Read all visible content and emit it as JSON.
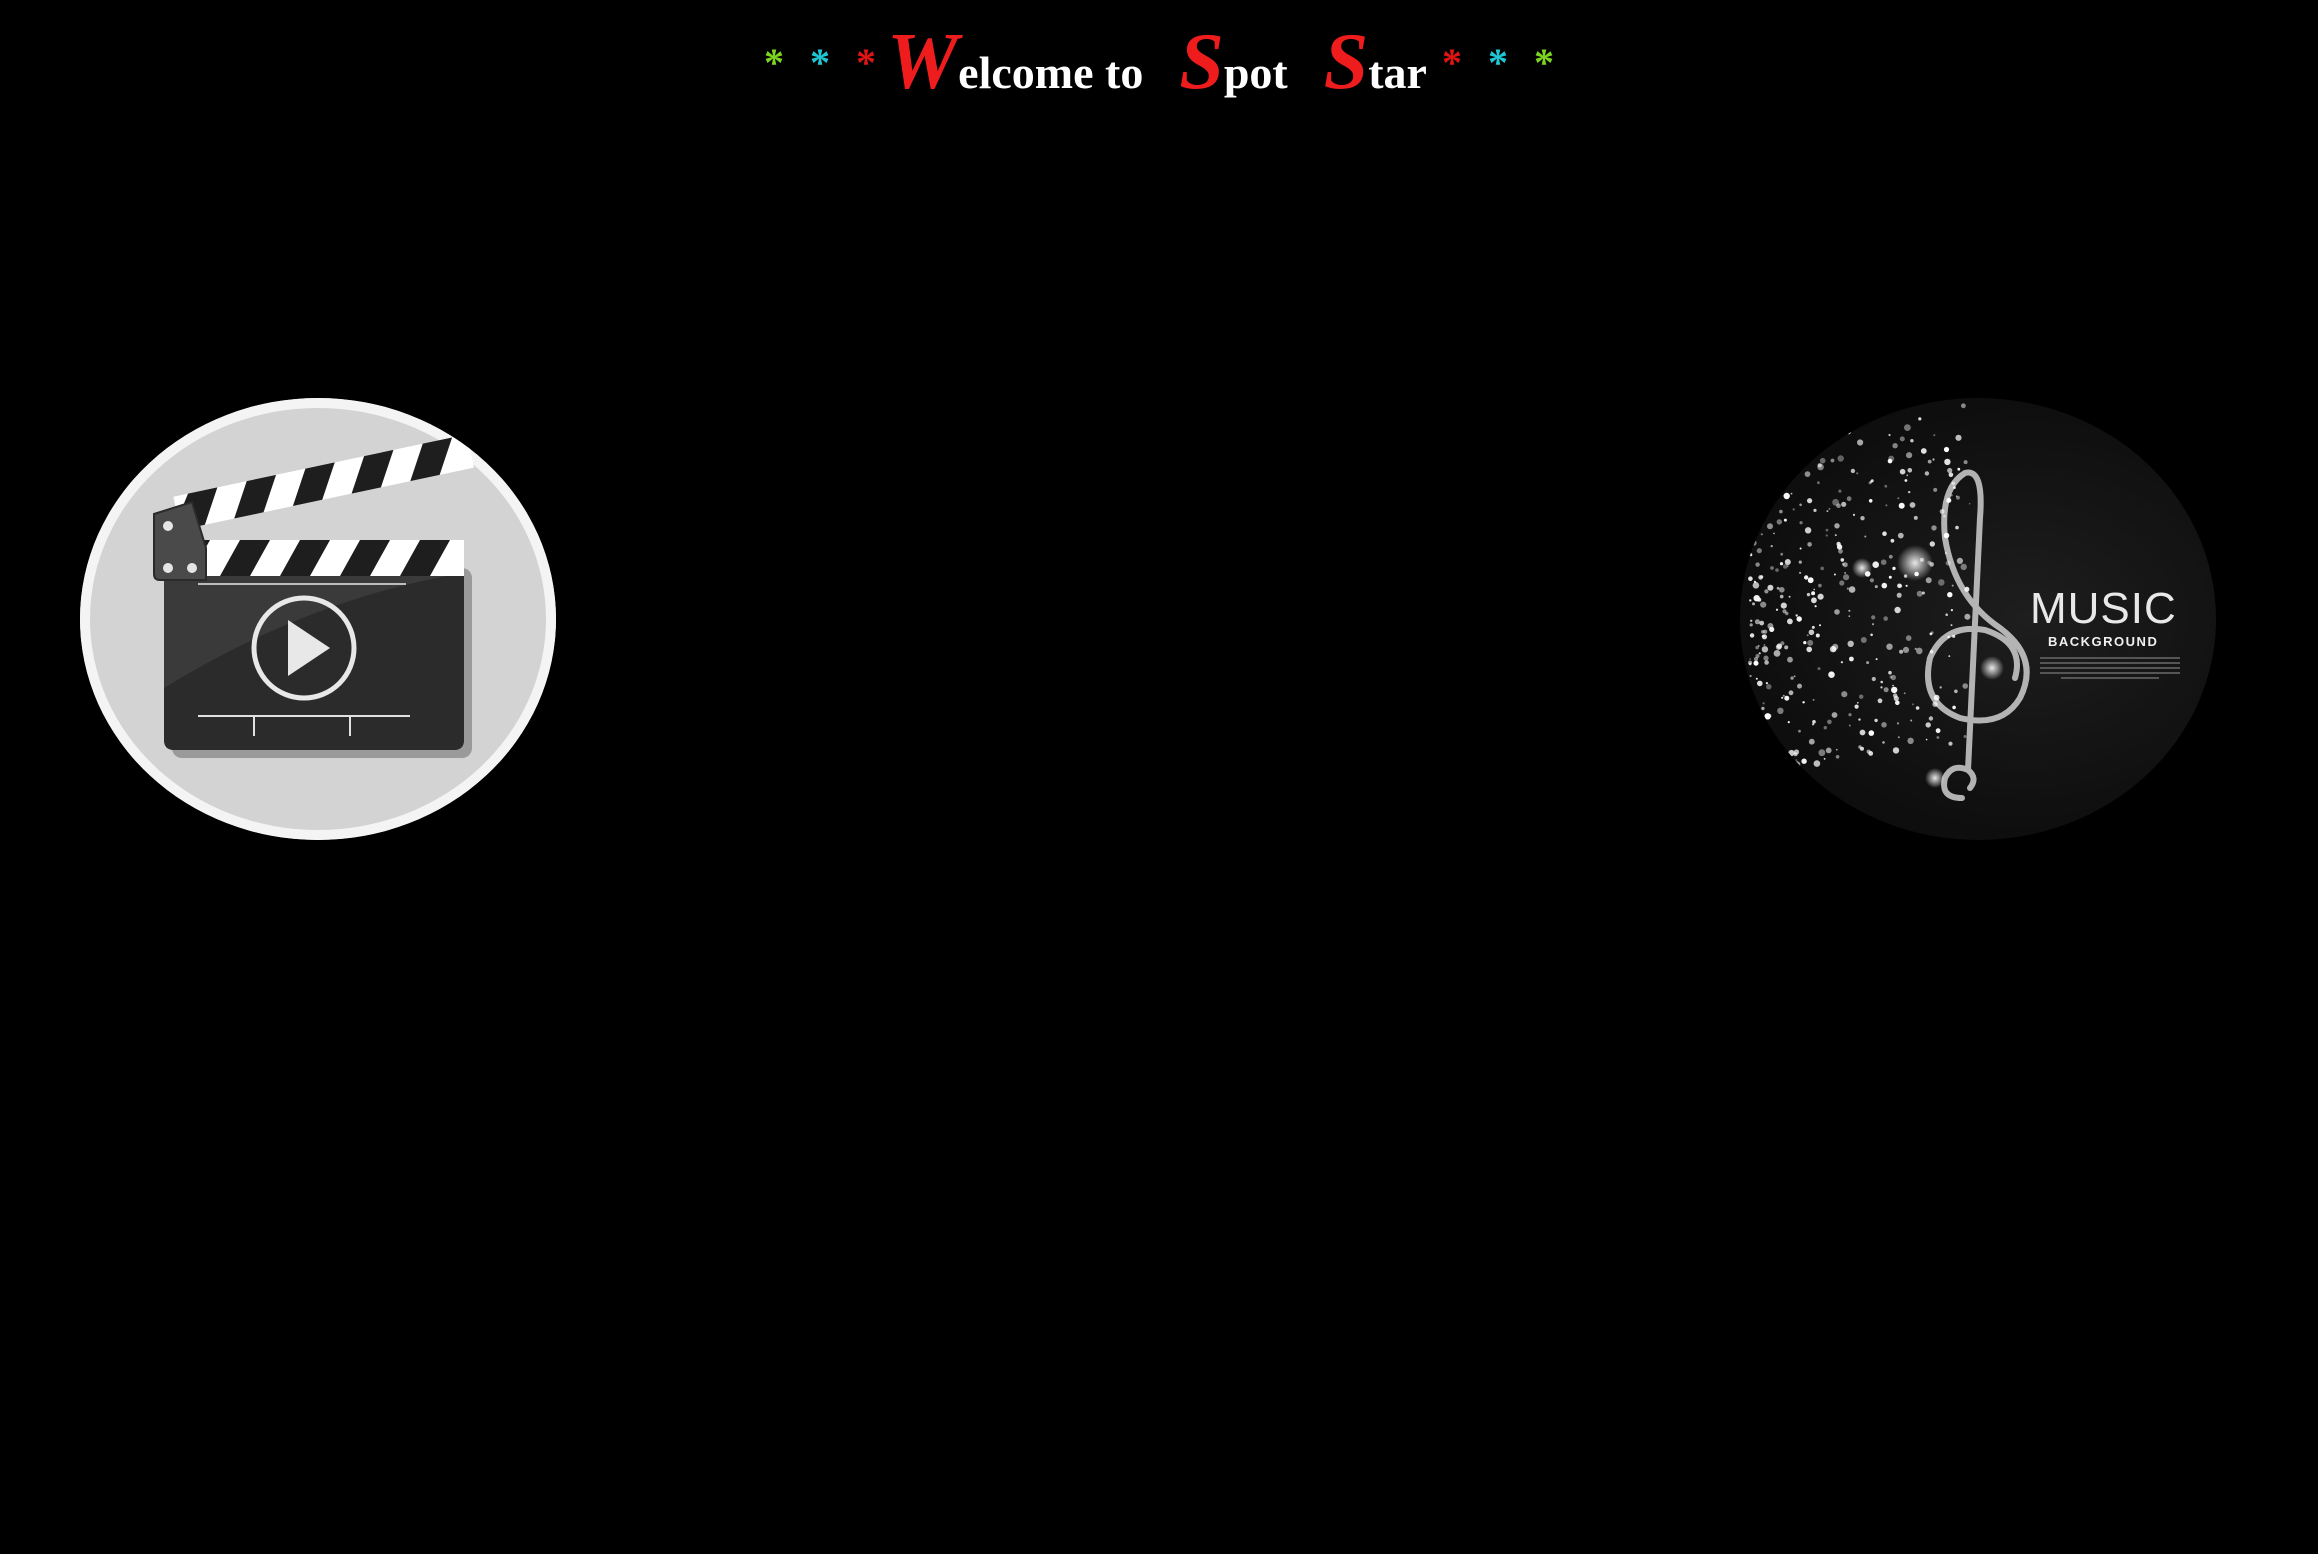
{
  "header": {
    "stars_left": [
      "*",
      "*",
      "*"
    ],
    "stars_right": [
      "*",
      "*",
      "*"
    ],
    "words": [
      {
        "cap": "W",
        "rest": "elcome to"
      },
      {
        "cap": "S",
        "rest": "pot"
      },
      {
        "cap": "S",
        "rest": "tar"
      }
    ]
  },
  "links": {
    "video": {
      "icon": "clapperboard-play-icon"
    },
    "music": {
      "label": "MUSIC",
      "sublabel": "BACKGROUND",
      "icon": "treble-clef-sparkle-icon"
    }
  },
  "colors": {
    "background": "#000000",
    "title_text": "#ffffff",
    "accent_red": "#ee1c1c",
    "star_green": "#7ed321",
    "star_cyan": "#1fc7d4",
    "star_red": "#e01414"
  }
}
